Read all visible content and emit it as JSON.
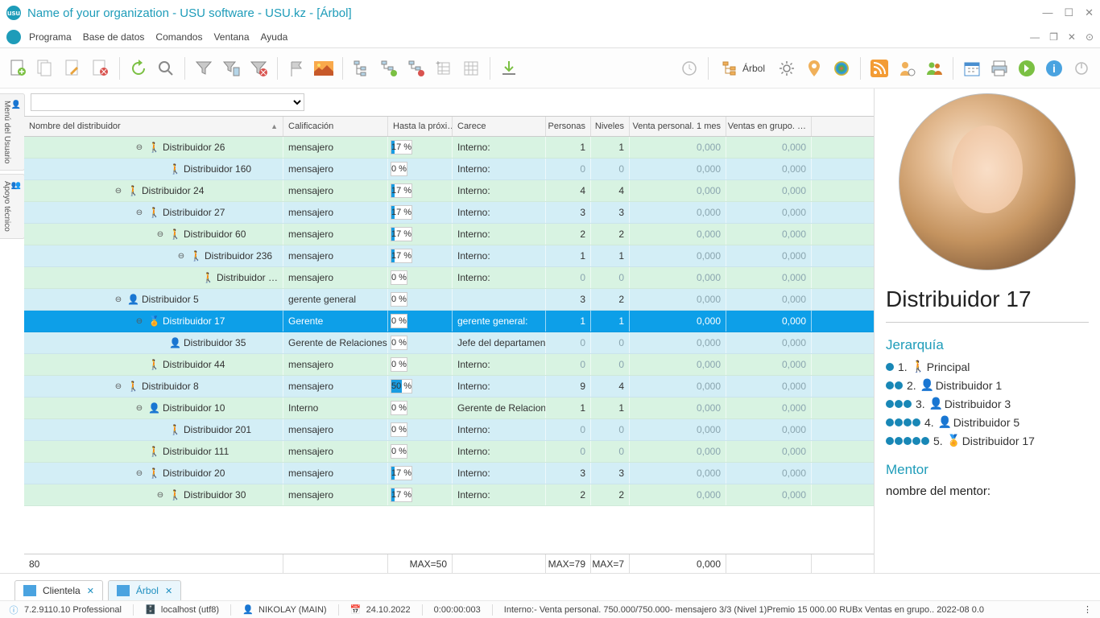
{
  "title": "Name of your organization - USU software - USU.kz - [Árbol]",
  "menus": [
    "Programa",
    "Base de datos",
    "Comandos",
    "Ventana",
    "Ayuda"
  ],
  "arbol_label": "Árbol",
  "side_tabs": [
    {
      "label": "Menú del Usuario",
      "icon": "👤"
    },
    {
      "label": "Apoyo técnico",
      "icon": "👥"
    }
  ],
  "grid": {
    "headers": {
      "name": "Nombre del distribuidor",
      "cal": "Calificación",
      "hasta": "Hasta la próxi…",
      "carece": "Carece",
      "pers": "Personas",
      "niv": "Niveles",
      "vp": "Venta personal. 1 mes",
      "vg": "Ventas en grupo. …"
    },
    "rows": [
      {
        "indent": 5,
        "exp": true,
        "icon": "🚶",
        "ic": "#1e7fc4",
        "name": "Distribuidor 26",
        "cal": "mensajero",
        "pct": 17,
        "car": "Interno:",
        "pers": "1",
        "niv": "1",
        "vp": "0,000",
        "vg": "0,000",
        "bg": "green",
        "dimNums": false
      },
      {
        "indent": 6,
        "exp": false,
        "icon": "🚶",
        "ic": "#1e7fc4",
        "name": "Distribuidor 160",
        "cal": "mensajero",
        "pct": 0,
        "car": "Interno:",
        "pers": "0",
        "niv": "0",
        "vp": "0,000",
        "vg": "0,000",
        "bg": "blue",
        "dimNums": true
      },
      {
        "indent": 4,
        "exp": true,
        "icon": "🚶",
        "ic": "#1e7fc4",
        "name": "Distribuidor 24",
        "cal": "mensajero",
        "pct": 17,
        "car": "Interno:",
        "pers": "4",
        "niv": "4",
        "vp": "0,000",
        "vg": "0,000",
        "bg": "green",
        "dimNums": false
      },
      {
        "indent": 5,
        "exp": true,
        "icon": "🚶",
        "ic": "#1e7fc4",
        "name": "Distribuidor 27",
        "cal": "mensajero",
        "pct": 17,
        "car": "Interno:",
        "pers": "3",
        "niv": "3",
        "vp": "0,000",
        "vg": "0,000",
        "bg": "blue",
        "dimNums": false
      },
      {
        "indent": 6,
        "exp": true,
        "icon": "🚶",
        "ic": "#1e7fc4",
        "name": "Distribuidor 60",
        "cal": "mensajero",
        "pct": 17,
        "car": "Interno:",
        "pers": "2",
        "niv": "2",
        "vp": "0,000",
        "vg": "0,000",
        "bg": "green",
        "dimNums": false
      },
      {
        "indent": 7,
        "exp": true,
        "icon": "🚶",
        "ic": "#1e7fc4",
        "name": "Distribuidor 236",
        "cal": "mensajero",
        "pct": 17,
        "car": "Interno:",
        "pers": "1",
        "niv": "1",
        "vp": "0,000",
        "vg": "0,000",
        "bg": "blue",
        "dimNums": false
      },
      {
        "indent": 8,
        "exp": false,
        "icon": "🚶",
        "ic": "#1e7fc4",
        "name": "Distribuidor …",
        "cal": "mensajero",
        "pct": 0,
        "car": "Interno:",
        "pers": "0",
        "niv": "0",
        "vp": "0,000",
        "vg": "0,000",
        "bg": "green",
        "dimNums": true
      },
      {
        "indent": 4,
        "exp": true,
        "icon": "👤",
        "ic": "#d47a2a",
        "name": "Distribuidor 5",
        "cal": "gerente general",
        "pct": 0,
        "car": "",
        "pers": "3",
        "niv": "2",
        "vp": "0,000",
        "vg": "0,000",
        "bg": "blue",
        "dimNums": false
      },
      {
        "indent": 5,
        "exp": true,
        "icon": "🏅",
        "ic": "#6ab82e",
        "name": "Distribuidor 17",
        "cal": "Gerente",
        "pct": 0,
        "car": "gerente general:",
        "pers": "1",
        "niv": "1",
        "vp": "0,000",
        "vg": "0,000",
        "bg": "sel",
        "dimNums": false
      },
      {
        "indent": 6,
        "exp": false,
        "icon": "👤",
        "ic": "#b34a4a",
        "name": "Distribuidor 35",
        "cal": "Gerente de Relaciones …",
        "pct": 0,
        "car": "Jefe del departamento:",
        "pers": "0",
        "niv": "0",
        "vp": "0,000",
        "vg": "0,000",
        "bg": "blue",
        "dimNums": true
      },
      {
        "indent": 5,
        "exp": false,
        "icon": "🚶",
        "ic": "#1e7fc4",
        "name": "Distribuidor 44",
        "cal": "mensajero",
        "pct": 0,
        "car": "Interno:",
        "pers": "0",
        "niv": "0",
        "vp": "0,000",
        "vg": "0,000",
        "bg": "green",
        "dimNums": true
      },
      {
        "indent": 4,
        "exp": true,
        "icon": "🚶",
        "ic": "#1e7fc4",
        "name": "Distribuidor 8",
        "cal": "mensajero",
        "pct": 50,
        "car": "Interno:",
        "pers": "9",
        "niv": "4",
        "vp": "0,000",
        "vg": "0,000",
        "bg": "blue",
        "dimNums": false
      },
      {
        "indent": 5,
        "exp": true,
        "icon": "👤",
        "ic": "#6ab82e",
        "name": "Distribuidor 10",
        "cal": "Interno",
        "pct": 0,
        "car": "Gerente de Relacione…",
        "pers": "1",
        "niv": "1",
        "vp": "0,000",
        "vg": "0,000",
        "bg": "green",
        "dimNums": false
      },
      {
        "indent": 6,
        "exp": false,
        "icon": "🚶",
        "ic": "#1e7fc4",
        "name": "Distribuidor 201",
        "cal": "mensajero",
        "pct": 0,
        "car": "Interno:",
        "pers": "0",
        "niv": "0",
        "vp": "0,000",
        "vg": "0,000",
        "bg": "blue",
        "dimNums": true
      },
      {
        "indent": 5,
        "exp": false,
        "icon": "🚶",
        "ic": "#1e7fc4",
        "name": "Distribuidor 111",
        "cal": "mensajero",
        "pct": 0,
        "car": "Interno:",
        "pers": "0",
        "niv": "0",
        "vp": "0,000",
        "vg": "0,000",
        "bg": "green",
        "dimNums": true
      },
      {
        "indent": 5,
        "exp": true,
        "icon": "🚶",
        "ic": "#1e7fc4",
        "name": "Distribuidor 20",
        "cal": "mensajero",
        "pct": 17,
        "car": "Interno:",
        "pers": "3",
        "niv": "3",
        "vp": "0,000",
        "vg": "0,000",
        "bg": "blue",
        "dimNums": false
      },
      {
        "indent": 6,
        "exp": true,
        "icon": "🚶",
        "ic": "#1e7fc4",
        "name": "Distribuidor 30",
        "cal": "mensajero",
        "pct": 17,
        "car": "Interno:",
        "pers": "2",
        "niv": "2",
        "vp": "0,000",
        "vg": "0,000",
        "bg": "green",
        "dimNums": false
      }
    ],
    "footer": {
      "count": "80",
      "max_hasta": "MAX=50",
      "max_pers": "MAX=79",
      "max_niv": "MAX=7",
      "vp": "0,000"
    }
  },
  "detail": {
    "name": "Distribuidor 17",
    "hierarchy_title": "Jerarquía",
    "hierarchy": [
      {
        "dots": 1,
        "n": "1.",
        "icon": "🚶",
        "ic": "#1e7fc4",
        "label": "Principal"
      },
      {
        "dots": 2,
        "n": "2.",
        "icon": "👤",
        "ic": "#6ab82e",
        "label": "Distribuidor 1"
      },
      {
        "dots": 3,
        "n": "3.",
        "icon": "👤",
        "ic": "#d47a2a",
        "label": "Distribuidor 3"
      },
      {
        "dots": 4,
        "n": "4.",
        "icon": "👤",
        "ic": "#d47a2a",
        "label": "Distribuidor 5"
      },
      {
        "dots": 5,
        "n": "5.",
        "icon": "🏅",
        "ic": "#6ab82e",
        "label": "Distribuidor 17"
      }
    ],
    "mentor_title": "Mentor",
    "mentor_label": "nombre del mentor:"
  },
  "tabs": [
    {
      "label": "Clientela",
      "active": false
    },
    {
      "label": "Árbol",
      "active": true
    }
  ],
  "status": {
    "version": "7.2.9110.10 Professional",
    "db": "localhost (utf8)",
    "user": "NIKOLAY (MAIN)",
    "date": "24.10.2022",
    "time": "0:00:00:003",
    "msg": "Interno:- Venta personal. 750.000/750.000- mensajero 3/3 (Nivel 1)Premio 15 000.00 RUBx   Ventas en grupo.. 2022-08 0.0"
  }
}
